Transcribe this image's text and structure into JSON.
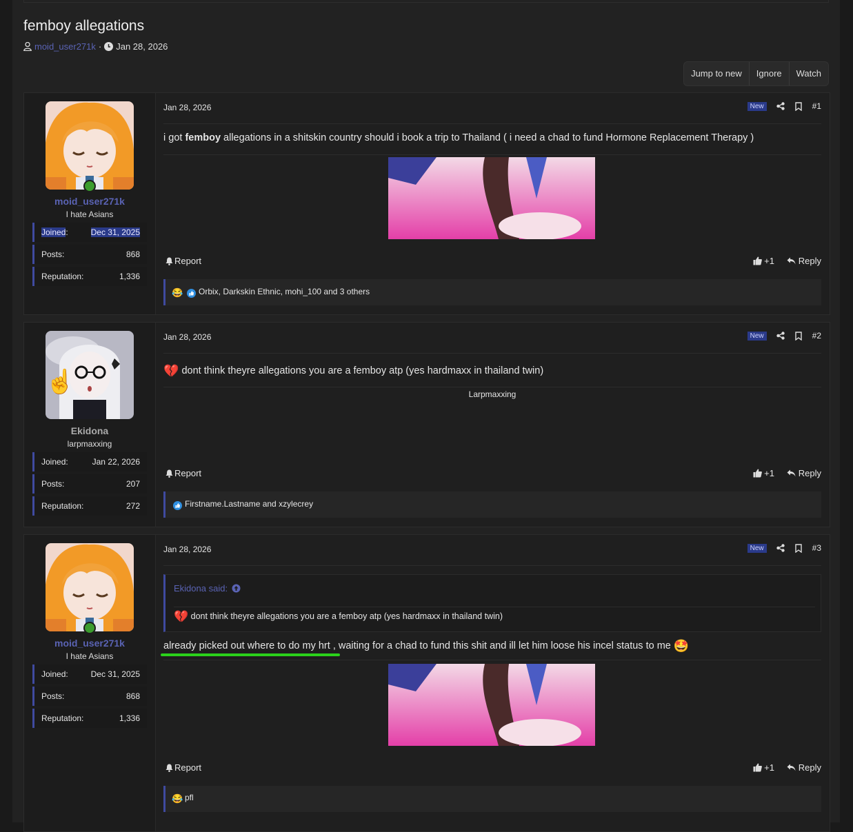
{
  "thread": {
    "title": "femboy allegations",
    "author": "moid_user271k",
    "separator": "·",
    "date": "Jan 28, 2026"
  },
  "thread_buttons": {
    "jump": "Jump to new",
    "ignore": "Ignore",
    "watch": "Watch"
  },
  "labels": {
    "joined": "Joined",
    "colon": ":",
    "posts": "Posts:",
    "reputation": "Reputation:",
    "report": "Report",
    "plus_one": "+1",
    "reply": "Reply",
    "new": "New"
  },
  "posts": [
    {
      "username": "moid_user271k",
      "user_title": "I hate Asians",
      "joined": "Dec 31, 2025",
      "posts": "868",
      "reputation": "1,336",
      "date": "Jan 28, 2026",
      "number": "#1",
      "text_pre": "i got ",
      "text_bold": "femboy",
      "text_post": " allegations in a shitskin country should i book a trip to Thailand ( i need a chad to fund Hormone Replacement Therapy )",
      "reactions": "Orbix, Darkskin Ethnic, mohi_100 and 3 others"
    },
    {
      "username": "Ekidona",
      "user_title": "larpmaxxing",
      "joined": "Jan 22, 2026",
      "posts": "207",
      "reputation": "272",
      "date": "Jan 28, 2026",
      "number": "#2",
      "text": "dont think theyre allegations you are a femboy atp (yes hardmaxx in thailand twin)",
      "caption": "Larpmaxxing",
      "reactions": "Firstname.Lastname and xzylecrey"
    },
    {
      "username": "moid_user271k",
      "user_title": "I hate Asians",
      "joined": "Dec 31, 2025",
      "posts": "868",
      "reputation": "1,336",
      "date": "Jan 28, 2026",
      "number": "#3",
      "quote_author": "Ekidona said:",
      "quote_text": "dont think theyre allegations you are a femboy atp (yes hardmaxx in thailand twin)",
      "text": "already picked out where to do my hrt , waiting for a chad to fund this shit and ill let him loose his incel status to me",
      "reactions": "pfl"
    }
  ],
  "colors": {
    "accent": "#3f4aa0",
    "link": "#5a63b4",
    "ekidona_name": "#aaaaaa",
    "online": "#3b9c2e",
    "underline": "#2bd21b"
  }
}
